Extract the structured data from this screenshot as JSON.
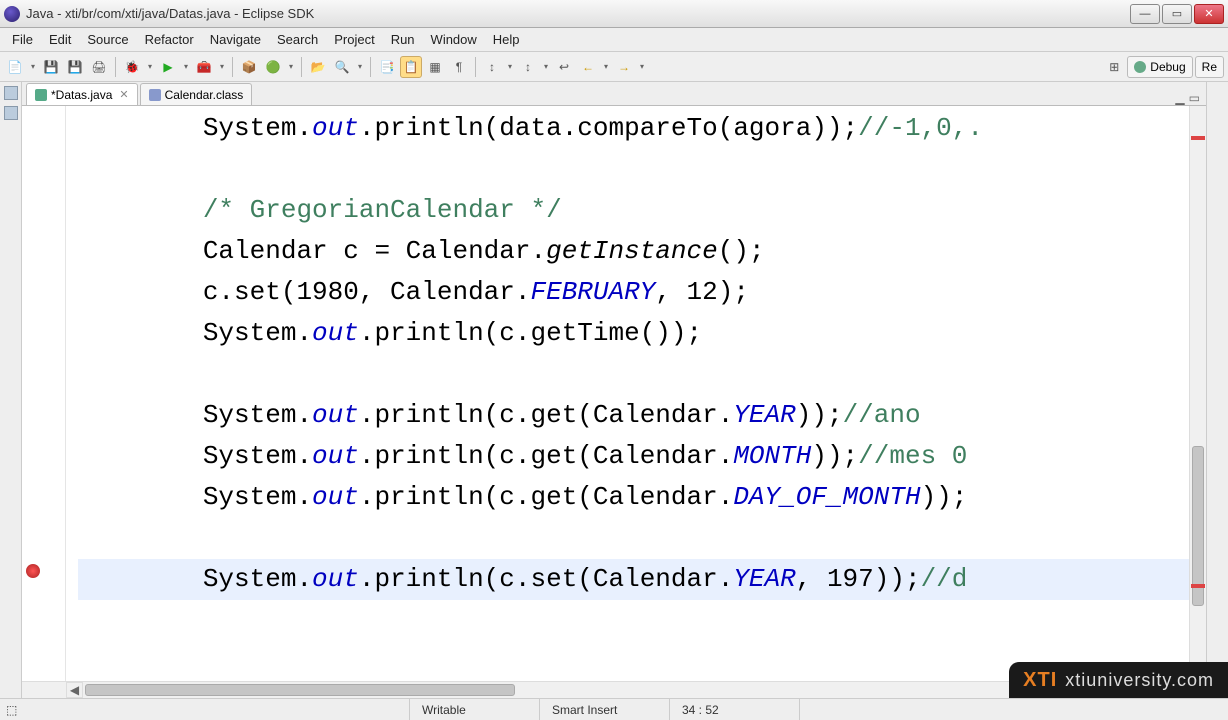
{
  "window": {
    "title": "Java - xti/br/com/xti/java/Datas.java - Eclipse SDK"
  },
  "menu": {
    "items": [
      "File",
      "Edit",
      "Source",
      "Refactor",
      "Navigate",
      "Search",
      "Project",
      "Run",
      "Window",
      "Help"
    ]
  },
  "tabs": {
    "active": {
      "label": "*Datas.java"
    },
    "other": {
      "label": "Calendar.class"
    }
  },
  "perspective": {
    "debug": "Debug",
    "resource": "Re"
  },
  "code": {
    "line1_a": "System.",
    "line1_b": "out",
    "line1_c": ".println(data.compareTo(agora));",
    "line1_d": "//-1,0,.",
    "blank": "",
    "line2": "/* GregorianCalendar */",
    "line3_a": "Calendar c = Calendar.",
    "line3_b": "getInstance",
    "line3_c": "();",
    "line4_a": "c.set(1980, Calendar.",
    "line4_b": "FEBRUARY",
    "line4_c": ", 12);",
    "line5_a": "System.",
    "line5_b": "out",
    "line5_c": ".println(c.getTime());",
    "line6_a": "System.",
    "line6_b": "out",
    "line6_c": ".println(c.get(Calendar.",
    "line6_d": "YEAR",
    "line6_e": "));",
    "line6_f": "//ano",
    "line7_a": "System.",
    "line7_b": "out",
    "line7_c": ".println(c.get(Calendar.",
    "line7_d": "MONTH",
    "line7_e": "));",
    "line7_f": "//mes 0",
    "line8_a": "System.",
    "line8_b": "out",
    "line8_c": ".println(c.get(Calendar.",
    "line8_d": "DAY_OF_MONTH",
    "line8_e": "));",
    "line9_a": "System.",
    "line9_b": "out",
    "line9_c": ".println(c.set(Calendar.",
    "line9_d": "YEAR",
    "line9_e": ", 197));",
    "line9_f": "//d"
  },
  "status": {
    "writable": "Writable",
    "insert": "Smart Insert",
    "pos": "34 : 52"
  },
  "watermark": {
    "brand": "XTI",
    "url": "xtiuniversity.com"
  }
}
